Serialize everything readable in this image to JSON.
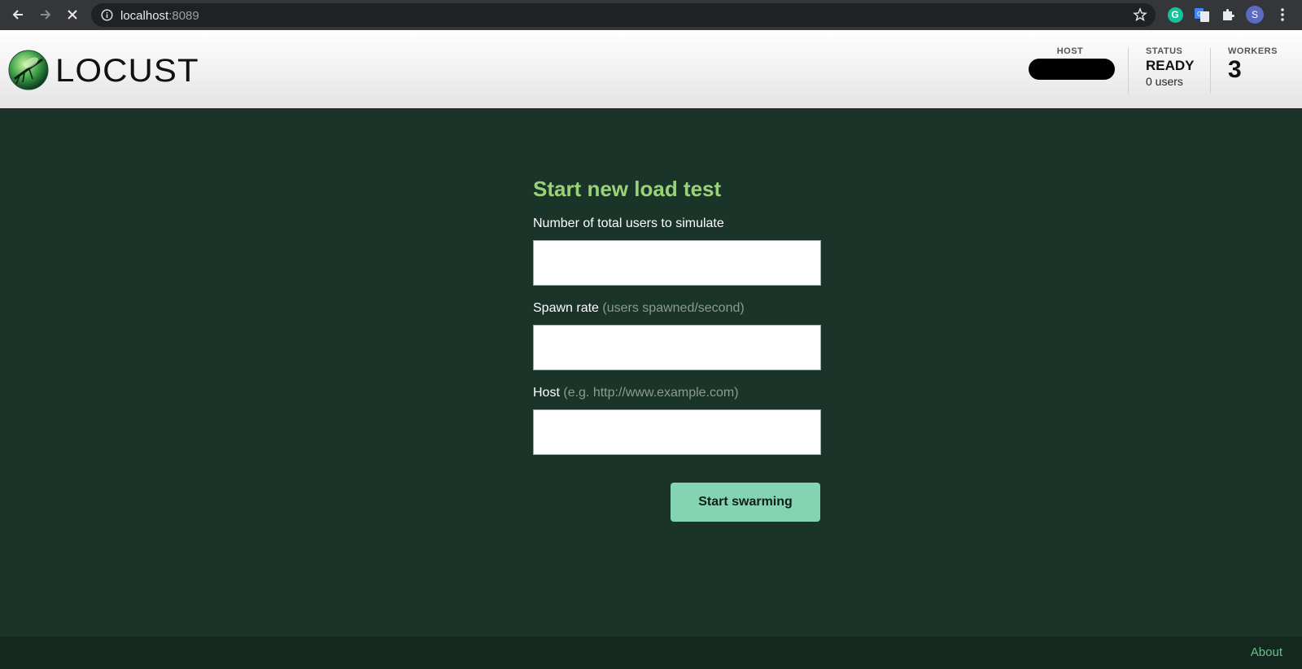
{
  "browser": {
    "url_host": "localhost",
    "url_port": ":8089",
    "profile_initial": "S",
    "grammarly_letter": "G",
    "icons": [
      "back-arrow-icon",
      "forward-arrow-icon",
      "stop-icon",
      "info-icon",
      "star-icon",
      "grammarly-icon",
      "translate-icon",
      "puzzle-icon",
      "profile-icon",
      "menu-icon"
    ]
  },
  "header": {
    "logo_text": "LOCUST",
    "host_label": "HOST",
    "status_label": "STATUS",
    "status_value": "READY",
    "users_value": "0 users",
    "workers_label": "WORKERS",
    "workers_value": "3"
  },
  "form": {
    "title": "Start new load test",
    "users_label": "Number of total users to simulate",
    "spawn_label": "Spawn rate",
    "spawn_hint": "(users spawned/second)",
    "host_label": "Host",
    "host_hint": "(e.g. http://www.example.com)",
    "users_value": "",
    "spawn_value": "",
    "host_value": "",
    "submit_label": "Start swarming"
  },
  "footer": {
    "about_label": "About"
  },
  "colors": {
    "background": "#1b3429",
    "title": "#9ad27a",
    "button": "#84d4b4",
    "footer": "#15281f"
  }
}
